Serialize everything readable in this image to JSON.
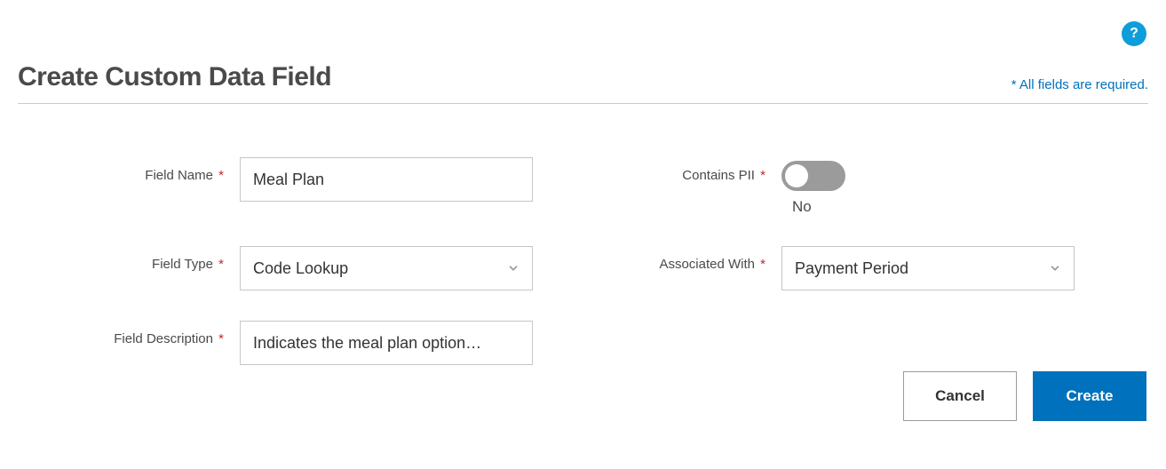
{
  "help": {
    "symbol": "?"
  },
  "header": {
    "title": "Create Custom Data Field",
    "required_note": "* All fields are required."
  },
  "form": {
    "field_name": {
      "label": "Field Name",
      "value": "Meal Plan"
    },
    "field_type": {
      "label": "Field Type",
      "value": "Code Lookup"
    },
    "field_description": {
      "label": "Field Description",
      "value": "Indicates the meal plan option…"
    },
    "contains_pii": {
      "label": "Contains PII",
      "value_label": "No"
    },
    "associated_with": {
      "label": "Associated With",
      "value": "Payment Period"
    }
  },
  "buttons": {
    "cancel": "Cancel",
    "create": "Create"
  }
}
